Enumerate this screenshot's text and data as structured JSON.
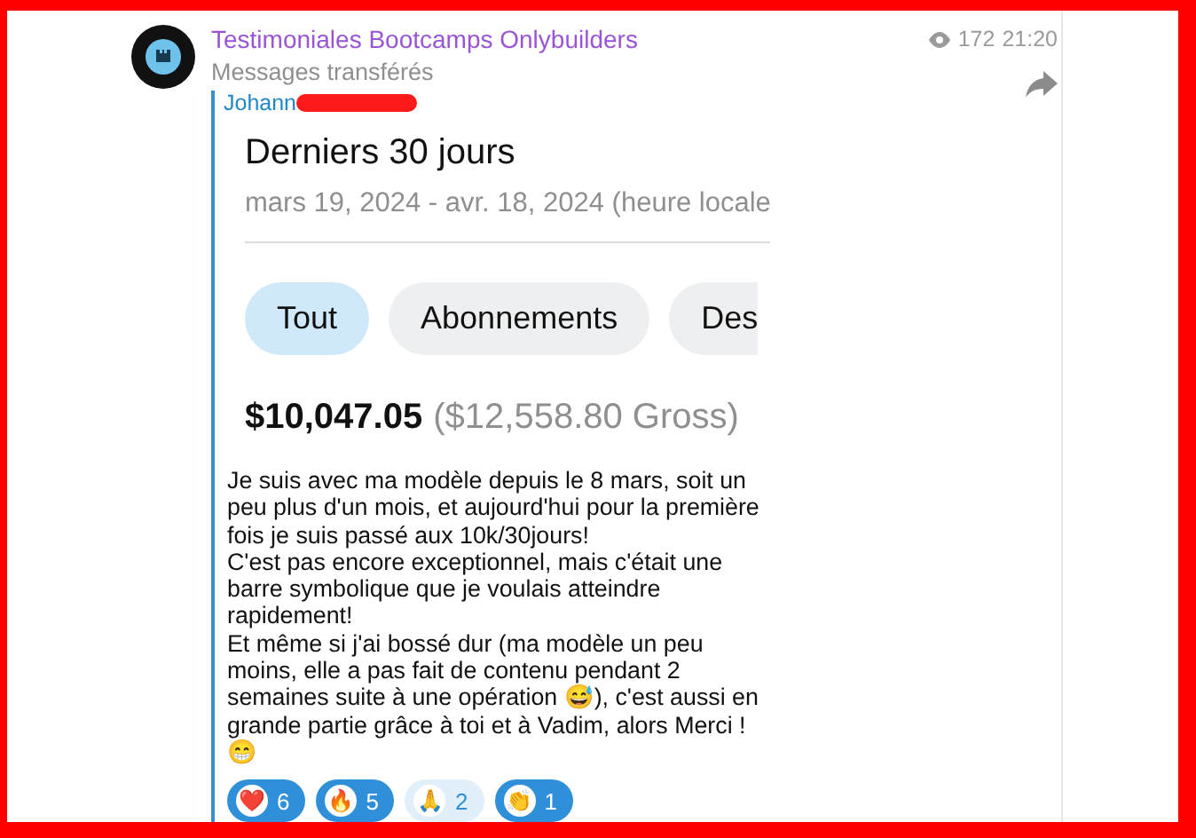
{
  "channel": {
    "name": "Testimoniales Bootcamps Onlybuilders",
    "subtitle": "Messages transférés",
    "views": "172",
    "time": "21:20"
  },
  "forward": {
    "author": "Johann",
    "screenshot": {
      "title": "Derniers 30 jours",
      "date_range": "mars 19, 2024 - avr. 18, 2024 (heure locale",
      "chips": [
        {
          "label": "Tout",
          "selected": true
        },
        {
          "label": "Abonnements",
          "selected": false
        },
        {
          "label": "Des",
          "selected": false
        }
      ],
      "net": "$10,047.05",
      "gross": "($12,558.80 Gross)"
    },
    "text": "Je suis avec ma modèle depuis le 8 mars, soit un peu plus d'un mois, et aujourd'hui pour la première fois je suis passé aux 10k/30jours!\nC'est pas encore exceptionnel, mais c'était une barre symbolique que je voulais atteindre rapidement!\nEt même si j'ai bossé dur (ma modèle un peu moins, elle a pas fait de contenu pendant 2 semaines suite à une opération 😅), c'est aussi en grande partie grâce à toi et à Vadim, alors Merci ! 😁"
  },
  "reactions": [
    {
      "emoji": "❤️",
      "count": "6",
      "selected": true
    },
    {
      "emoji": "🔥",
      "count": "5",
      "selected": true
    },
    {
      "emoji": "🙏",
      "count": "2",
      "selected": false
    },
    {
      "emoji": "👏",
      "count": "1",
      "selected": true
    }
  ]
}
